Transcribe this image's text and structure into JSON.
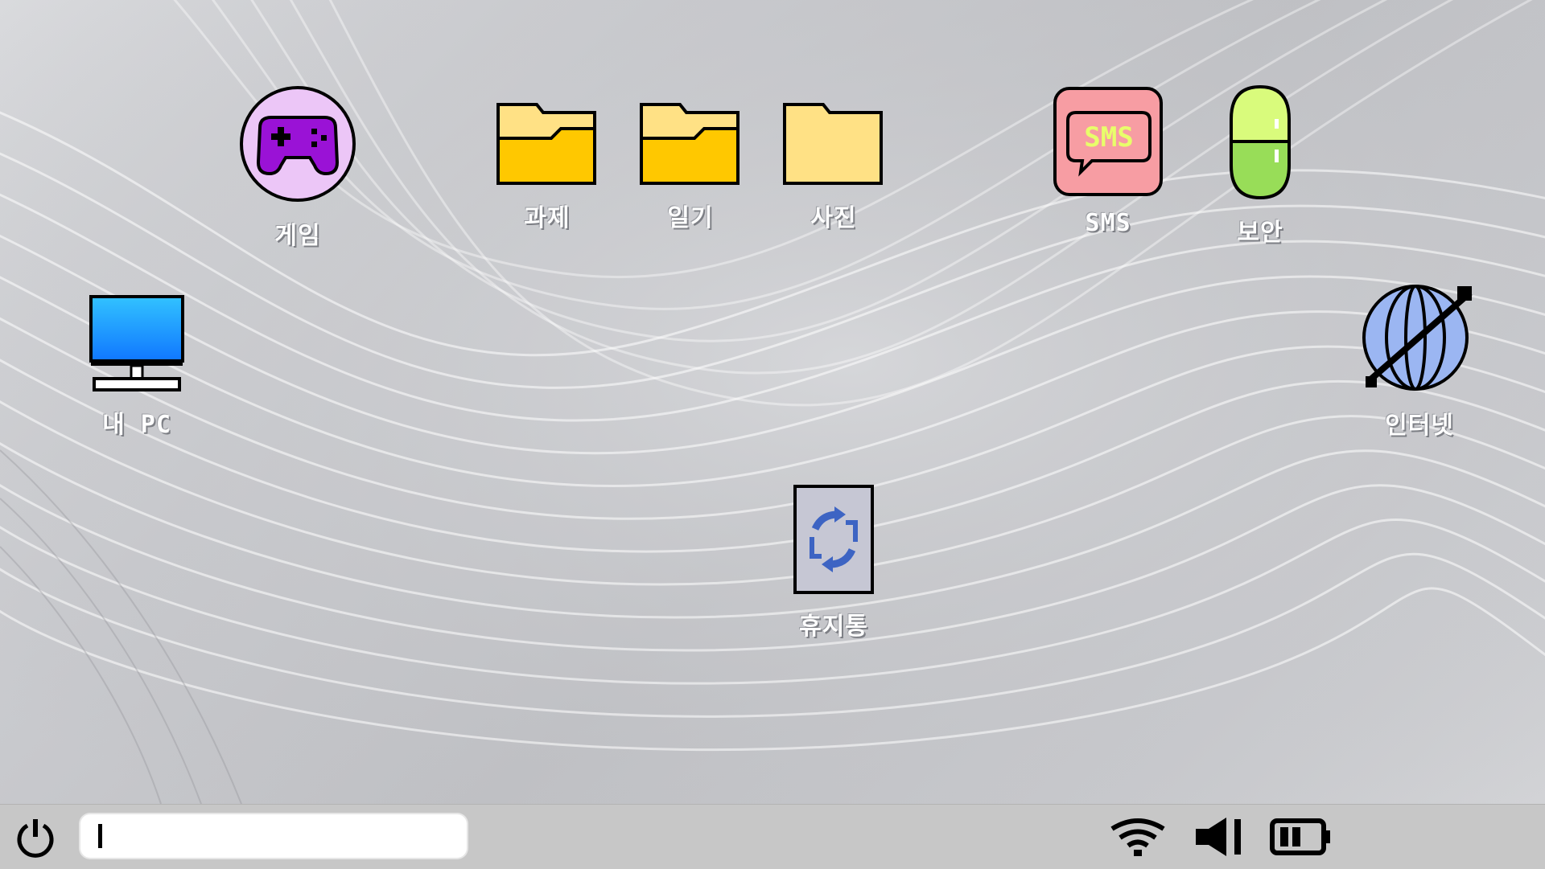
{
  "desktop": {
    "icons": [
      {
        "label": "게임",
        "icon": "gamepad-icon"
      },
      {
        "label": "과제",
        "icon": "folder-icon"
      },
      {
        "label": "일기",
        "icon": "folder-icon"
      },
      {
        "label": "사진",
        "icon": "folder-icon"
      },
      {
        "label": "SMS",
        "icon": "sms-chat-icon"
      },
      {
        "label": "보안",
        "icon": "pill-icon"
      },
      {
        "label": "내 PC",
        "icon": "monitor-icon"
      },
      {
        "label": "인터넷",
        "icon": "globe-icon"
      },
      {
        "label": "휴지통",
        "icon": "recycle-bin-icon"
      }
    ]
  },
  "taskbar": {
    "search": {
      "value": "",
      "placeholder": ""
    },
    "tray": [
      "wifi-icon",
      "volume-icon",
      "battery-icon"
    ],
    "battery_level": 0.5
  },
  "colors": {
    "folder": "#ffc800",
    "folder_light": "#ffe185",
    "gamepad": "#9a12d6",
    "gamepad_bg": "#ecc6f7",
    "sms_bg": "#f79da3",
    "sms_text": "#e8ff6a",
    "pill_top": "#d9fb7c",
    "pill_bottom": "#98dd58",
    "monitor": "#1b9bff",
    "globe": "#9bb6f2",
    "recycle": "#3d64c3",
    "taskbar": "#c7c7c7"
  }
}
